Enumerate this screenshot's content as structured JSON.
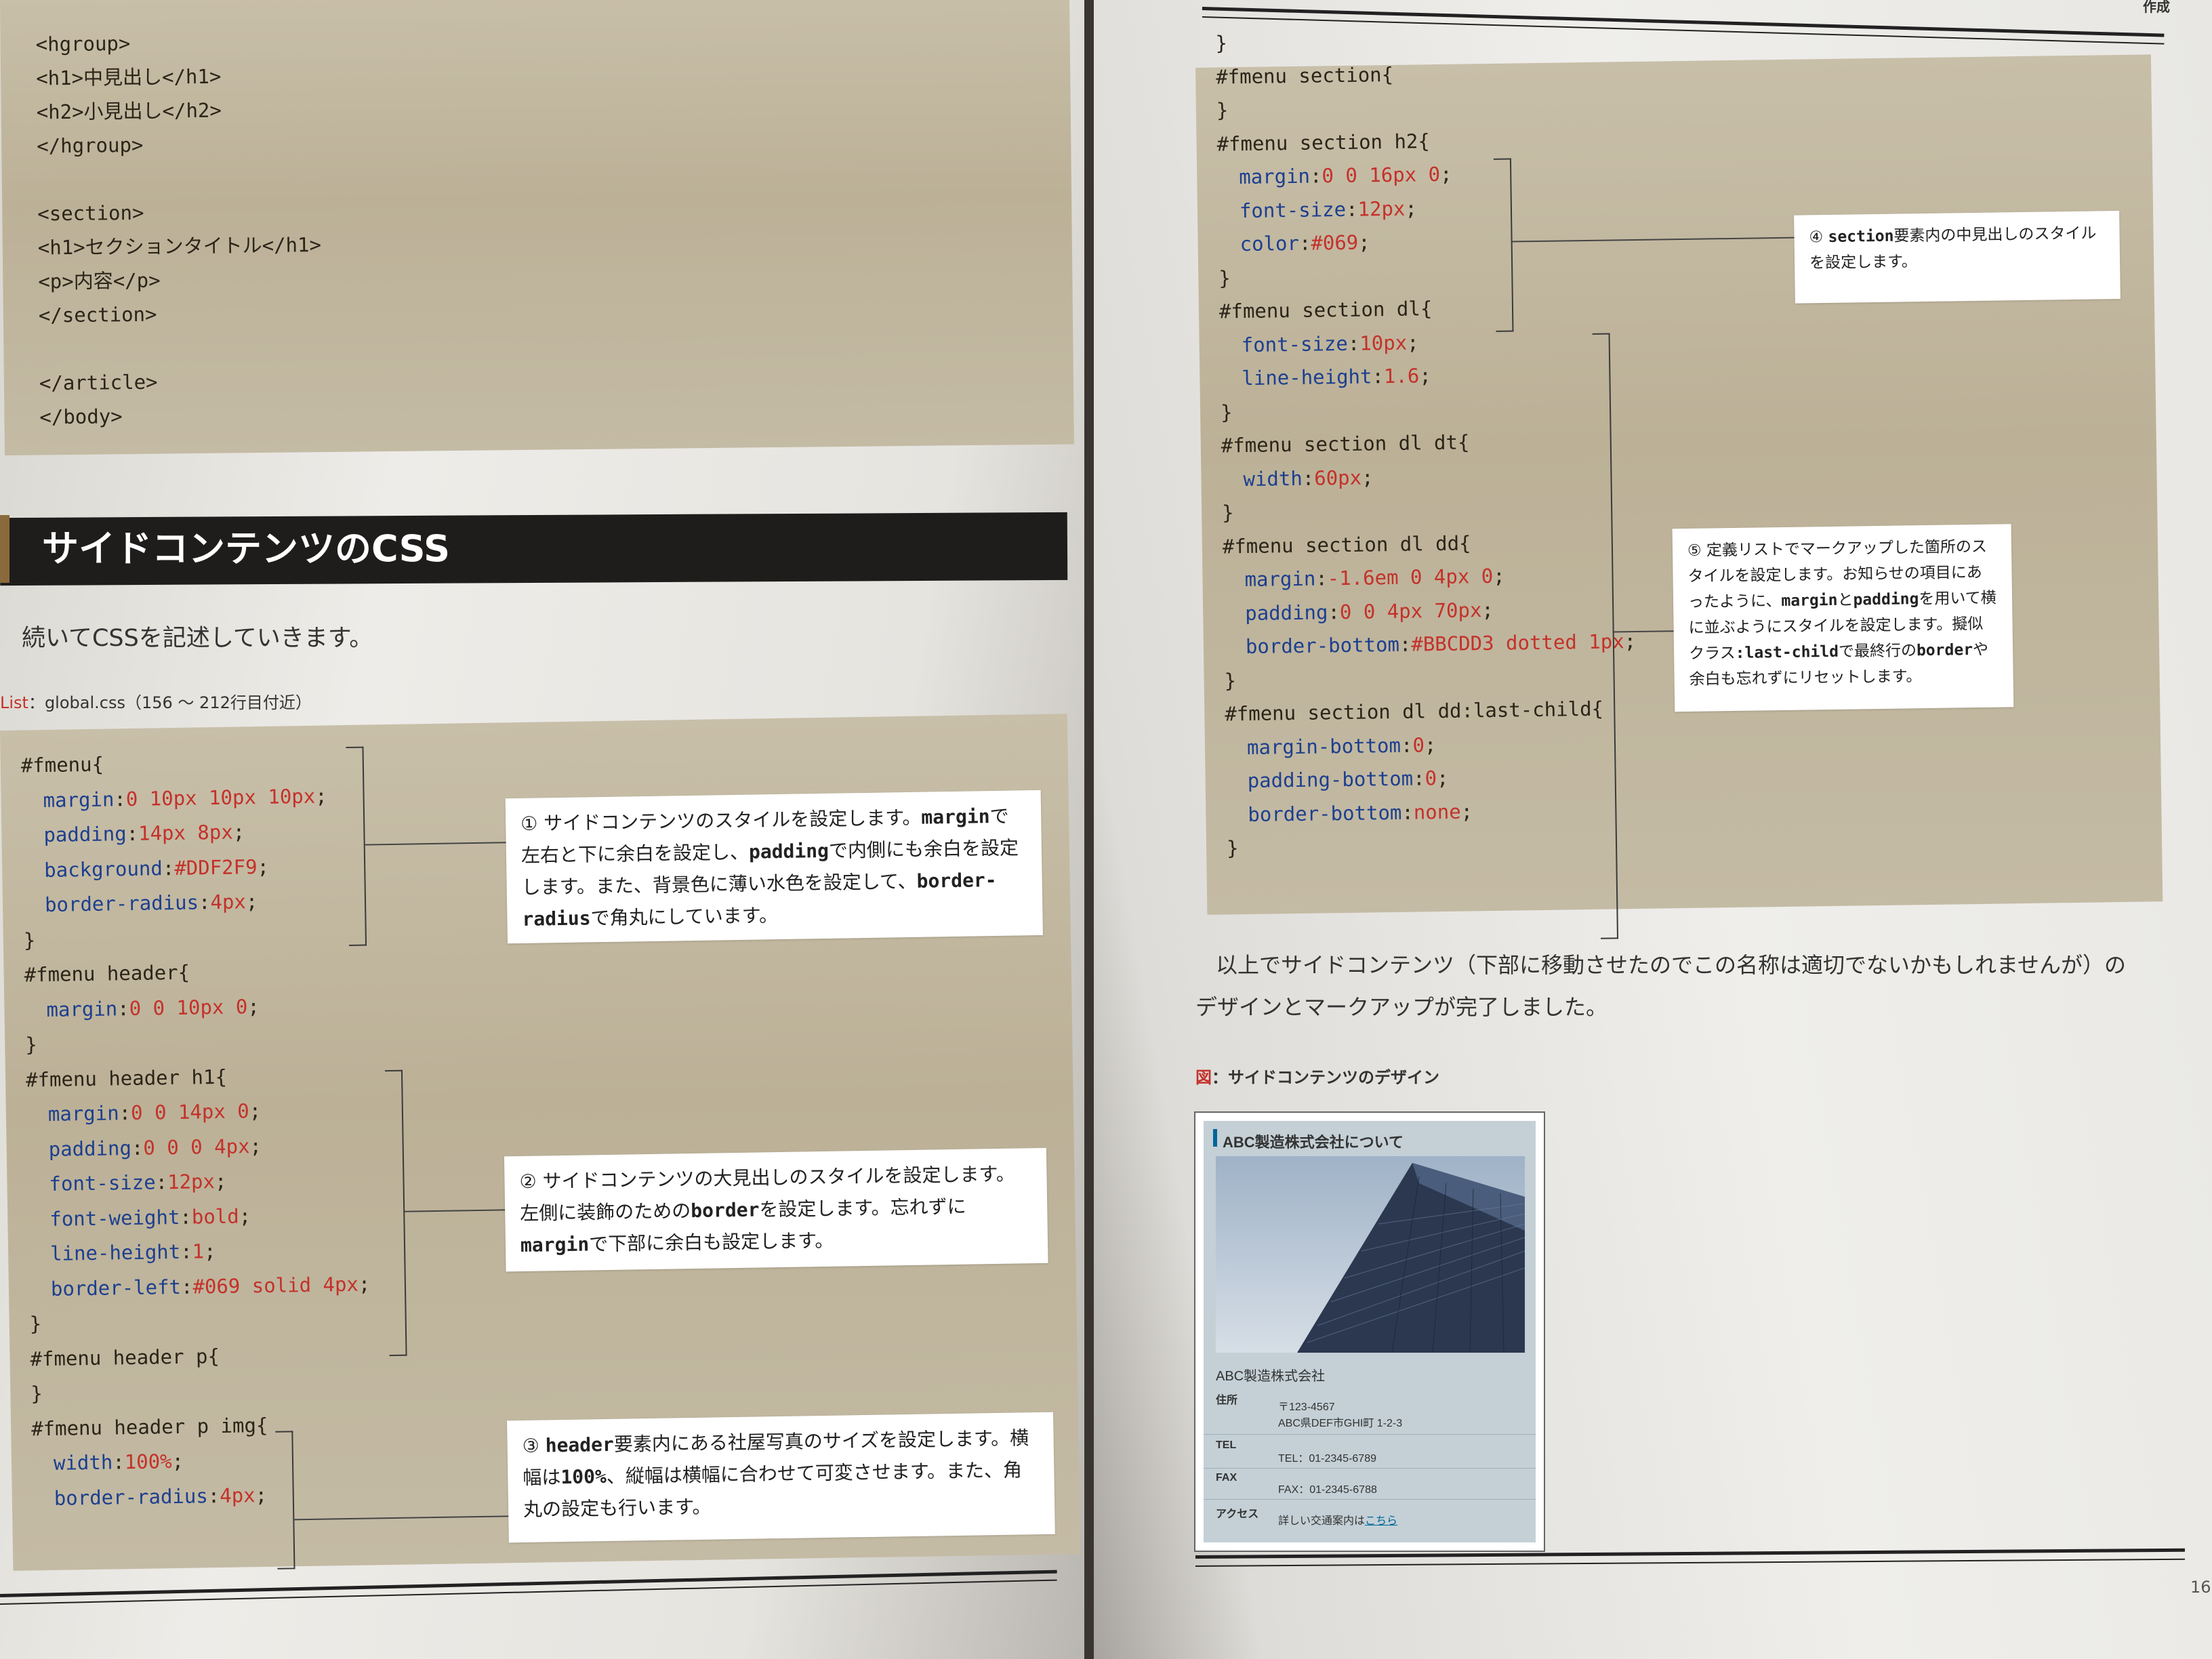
{
  "left_page": {
    "top_code": [
      "<hgroup>",
      "<h1>中見出し</h1>",
      "<h2>小見出し</h2>",
      "</hgroup>",
      "",
      "<section>",
      "<h1>セクションタイトル</h1>",
      "<p>内容</p>",
      "</section>",
      "",
      "</article>",
      "</body>"
    ],
    "heading": "サイドコンテンツのCSS",
    "intro": "続いてCSSを記述していきます。",
    "list_caption": {
      "prefix": "List",
      "text": "：global.css（156 ～ 212行目付近）"
    },
    "css_lines": [
      {
        "sel": "#fmenu{"
      },
      {
        "prop": "margin",
        "val": "0 10px 10px 10px"
      },
      {
        "prop": "padding",
        "val": "14px 8px"
      },
      {
        "prop": "background",
        "val": "#DDF2F9"
      },
      {
        "prop": "border-radius",
        "val": "4px"
      },
      {
        "sel": "}"
      },
      {
        "sel": "#fmenu header{"
      },
      {
        "prop": "margin",
        "val": "0 0 10px 0"
      },
      {
        "sel": "}"
      },
      {
        "sel": "#fmenu header h1{"
      },
      {
        "prop": "margin",
        "val": "0 0 14px 0"
      },
      {
        "prop": "padding",
        "val": "0 0 0 4px"
      },
      {
        "prop": "font-size",
        "val": "12px"
      },
      {
        "prop": "font-weight",
        "val": "bold"
      },
      {
        "prop": "line-height",
        "val": "1"
      },
      {
        "prop": "border-left",
        "val": "#069 solid 4px"
      },
      {
        "sel": "}"
      },
      {
        "sel": "#fmenu header p{"
      },
      {
        "sel": "}"
      },
      {
        "sel": "#fmenu header p img{"
      },
      {
        "prop": "width",
        "val": "100%"
      },
      {
        "prop": "border-radius",
        "val": "4px"
      }
    ],
    "notes": {
      "n1": [
        "① サイドコンテンツのスタイルを設定します。",
        "margin",
        "で左右と下に余白を設定し、",
        "padding",
        "で内側にも余白を設定します。また、背景色に薄い水色を設定して、",
        "border-radius",
        "で角丸にしています。"
      ],
      "n2": [
        "② サイドコンテンツの大見出しのスタイルを設定します。左側に装飾のための",
        "border",
        "を設定します。忘れずに",
        "margin",
        "で下部に余白も設定します。"
      ],
      "n3": [
        "③ ",
        "header",
        "要素内にある社屋写真のサイズを設定します。横幅は",
        "100%",
        "、縦幅は横幅に合わせて可変させます。また、角丸の設定も行います。"
      ]
    }
  },
  "right_page": {
    "corner_tag": "作成",
    "page_number": "16",
    "css_lines": [
      {
        "sel": "}"
      },
      {
        "sel": "#fmenu section{"
      },
      {
        "sel": "}"
      },
      {
        "sel": "#fmenu section h2{"
      },
      {
        "prop": "margin",
        "val": "0 0 16px 0"
      },
      {
        "prop": "font-size",
        "val": "12px"
      },
      {
        "prop": "color",
        "val": "#069"
      },
      {
        "sel": "}"
      },
      {
        "sel": "#fmenu section dl{"
      },
      {
        "prop": "font-size",
        "val": "10px"
      },
      {
        "prop": "line-height",
        "val": "1.6"
      },
      {
        "sel": "}"
      },
      {
        "sel": "#fmenu section dl dt{"
      },
      {
        "prop": "width",
        "val": "60px"
      },
      {
        "sel": "}"
      },
      {
        "sel": "#fmenu section dl dd{"
      },
      {
        "prop": "margin",
        "val": "-1.6em 0 4px 0"
      },
      {
        "prop": "padding",
        "val": "0 0 4px 70px"
      },
      {
        "prop": "border-bottom",
        "val": "#BBCDD3 dotted 1px"
      },
      {
        "sel": "}"
      },
      {
        "sel": "#fmenu section dl dd:last-child{"
      },
      {
        "prop": "margin-bottom",
        "val": "0"
      },
      {
        "prop": "padding-bottom",
        "val": "0"
      },
      {
        "prop": "border-bottom",
        "val": "none"
      },
      {
        "sel": "}"
      }
    ],
    "notes": {
      "n4": [
        "④ ",
        "section",
        "要素内の中見出しのスタイルを設定します。"
      ],
      "n5": [
        "⑤ 定義リストでマークアップした箇所のスタイルを設定します。お知らせの項目にあったように、",
        "margin",
        "と",
        "padding",
        "を用いて横に並ぶようにスタイルを設定します。擬似クラス",
        ":last-child",
        "で最終行の",
        "border",
        "や余白も忘れずにリセットします。"
      ]
    },
    "conclusion": [
      "以上でサイドコンテンツ（下部に移動させたのでこの名称は適切でないかもしれませんが）の",
      "デザインとマークアップが完了しました。"
    ],
    "figure_caption": {
      "prefix": "図",
      "text": "：サイドコンテンツのデザイン"
    },
    "figure": {
      "title": "ABC製造株式会社について",
      "company": "ABC製造株式会社",
      "rows": [
        {
          "label": "住所",
          "lines": [
            "〒123-4567",
            "ABC県DEF市GHI町 1-2-3"
          ]
        },
        {
          "label": "TEL",
          "lines": [
            "TEL：01-2345-6789"
          ]
        },
        {
          "label": "FAX",
          "lines": [
            "FAX：01-2345-6788"
          ]
        },
        {
          "label": "アクセス",
          "lines": [
            "詳しい交通案内は"
          ],
          "link": "こちら"
        }
      ]
    }
  },
  "colors": {
    "property": "#1c3f8f",
    "value": "#c4312a",
    "code_bg": "#c2b8a0",
    "heading_bg": "#1f1d1c"
  }
}
